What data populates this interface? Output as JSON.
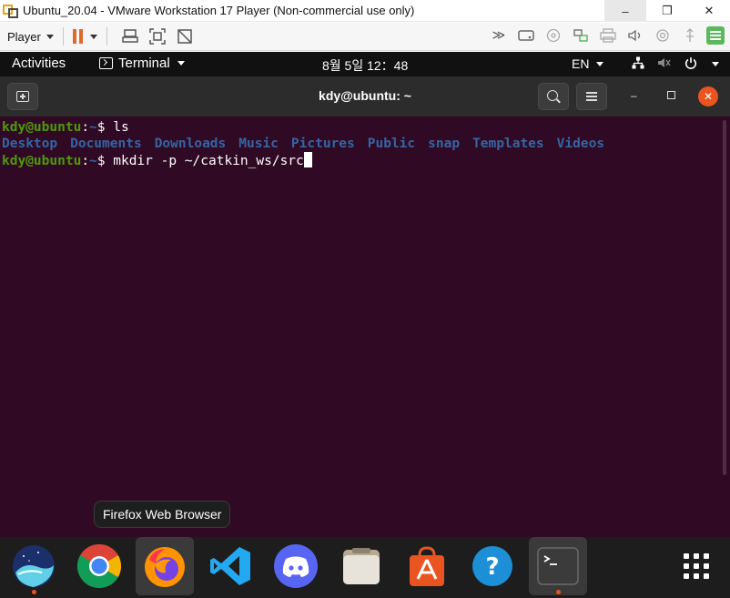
{
  "vm_window": {
    "title": "Ubuntu_20.04 - VMware Workstation 17 Player (Non-commercial use only)",
    "minimize": "–",
    "maximize": "❐",
    "close": "✕"
  },
  "vm_toolbar": {
    "player_menu": "Player"
  },
  "topbar": {
    "activities": "Activities",
    "app_menu": "Terminal",
    "clock": "8월 5일  12：48",
    "lang": "EN"
  },
  "terminal": {
    "title": "kdy@ubuntu: ~",
    "lines": {
      "l1_user": "kdy@ubuntu",
      "l1_sep": ":",
      "l1_path": "~",
      "l1_cmd": "$ ls",
      "l3_user": "kdy@ubuntu",
      "l3_sep": ":",
      "l3_path": "~",
      "l3_cmd": "$ mkdir -p ~/catkin_ws/src"
    },
    "ls_output": [
      "Desktop",
      "Documents",
      "Downloads",
      "Music",
      "Pictures",
      "Public",
      "snap",
      "Templates",
      "Videos"
    ]
  },
  "tooltip": "Firefox Web Browser",
  "dock": {
    "apps": [
      "Whale",
      "Google Chrome",
      "Firefox Web Browser",
      "Visual Studio Code",
      "Discord",
      "Files",
      "Ubuntu Software",
      "Help",
      "Terminal",
      "Show Applications"
    ]
  },
  "colors": {
    "terminal_bg": "#300a24",
    "prompt_user": "#4e9a06",
    "prompt_path": "#3465a4",
    "accent": "#e95420"
  }
}
